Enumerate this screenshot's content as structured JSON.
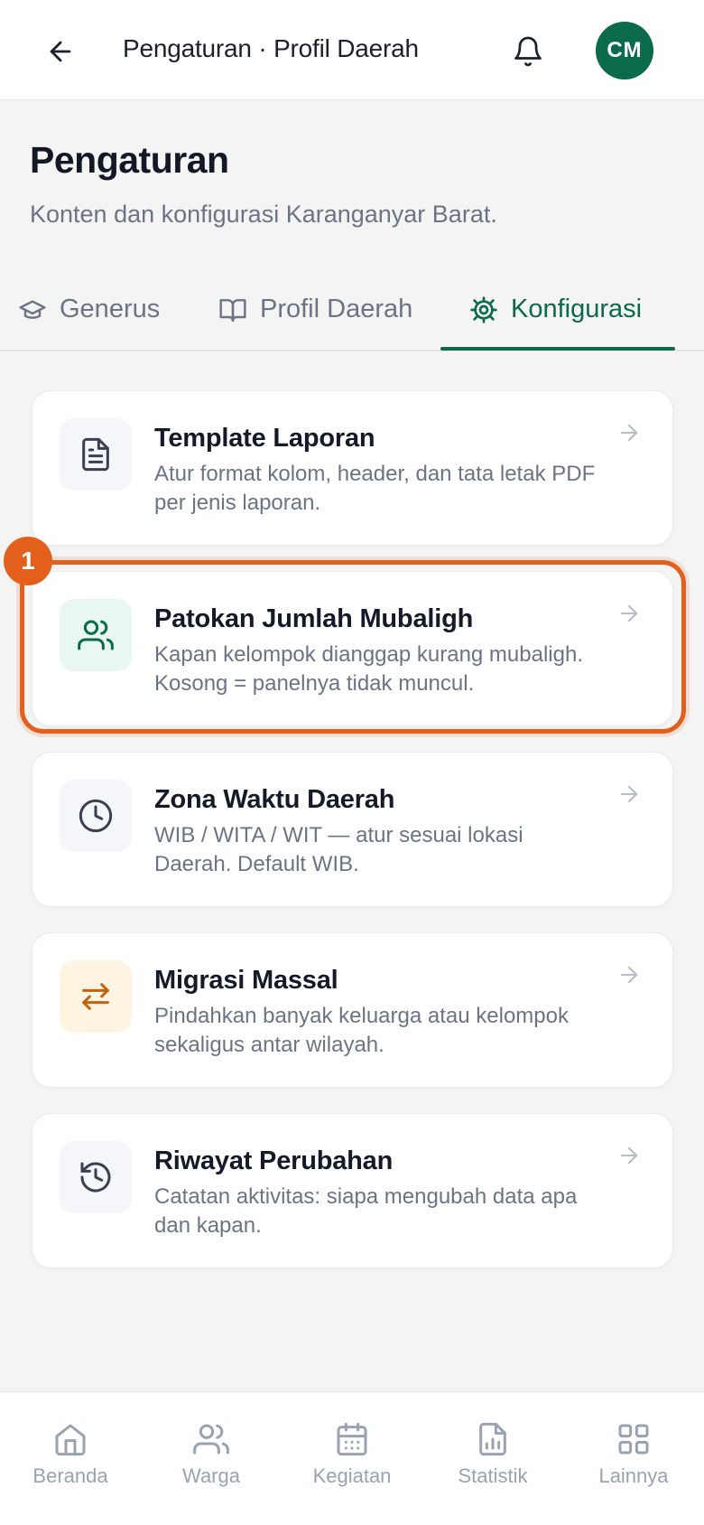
{
  "header": {
    "title": "Pengaturan · Profil Daerah",
    "avatar_initials": "CM",
    "avatar_color": "#0b6a4c"
  },
  "page": {
    "title": "Pengaturan",
    "subtitle": "Konten dan konfigurasi Karanganyar Barat."
  },
  "tabs": [
    {
      "label": "Generus",
      "icon": "graduation-cap-icon",
      "active": false
    },
    {
      "label": "Profil Daerah",
      "icon": "book-open-icon",
      "active": false
    },
    {
      "label": "Konfigurasi",
      "icon": "gear-icon",
      "active": true
    }
  ],
  "cards": [
    {
      "title": "Template Laporan",
      "description": "Atur format kolom, header, dan tata letak PDF per jenis laporan.",
      "icon": "document-icon"
    },
    {
      "title": "Patokan Jumlah Mubaligh",
      "description": "Kapan kelompok dianggap kurang mubaligh. Kosong = panelnya tidak muncul.",
      "icon": "users-icon"
    },
    {
      "title": "Zona Waktu Daerah",
      "description": "WIB / WITA / WIT — atur sesuai lokasi Daerah. Default WIB.",
      "icon": "clock-icon"
    },
    {
      "title": "Migrasi Massal",
      "description": "Pindahkan banyak keluarga atau kelompok sekaligus antar wilayah.",
      "icon": "swap-arrows-icon"
    },
    {
      "title": "Riwayat Perubahan",
      "description": "Catatan aktivitas: siapa mengubah data apa dan kapan.",
      "icon": "history-icon"
    }
  ],
  "annotation": {
    "badge": "1",
    "color": "#e2601b"
  },
  "bottom_nav": [
    {
      "label": "Beranda",
      "icon": "home-icon"
    },
    {
      "label": "Warga",
      "icon": "users-icon"
    },
    {
      "label": "Kegiatan",
      "icon": "calendar-icon"
    },
    {
      "label": "Statistik",
      "icon": "chart-file-icon"
    },
    {
      "label": "Lainnya",
      "icon": "grid-icon"
    }
  ]
}
